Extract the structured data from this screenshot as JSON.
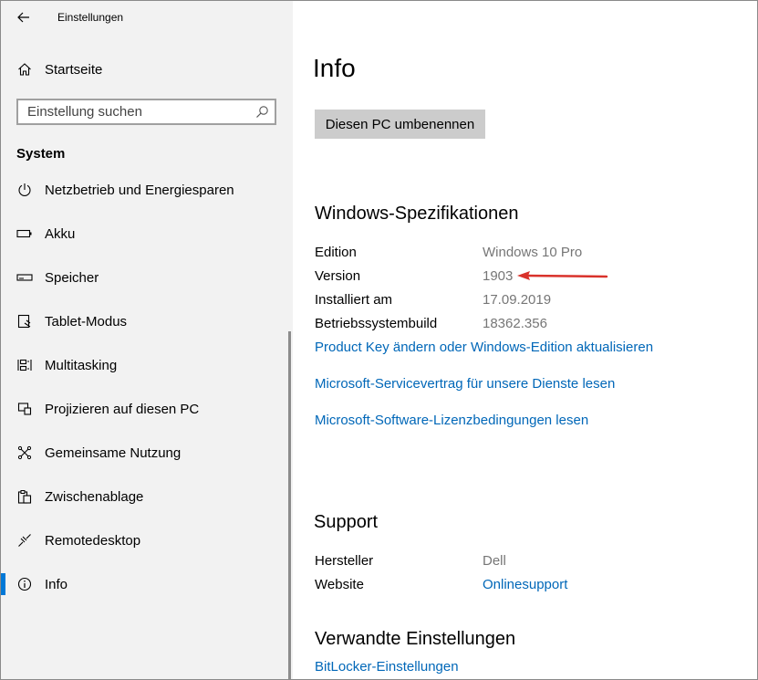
{
  "window": {
    "title": "Einstellungen"
  },
  "sidebar": {
    "home_label": "Startseite",
    "search_placeholder": "Einstellung suchen",
    "section_title": "System",
    "items": [
      {
        "label": "Netzbetrieb und Energiesparen",
        "icon": "power-icon"
      },
      {
        "label": "Akku",
        "icon": "battery-icon"
      },
      {
        "label": "Speicher",
        "icon": "storage-icon"
      },
      {
        "label": "Tablet-Modus",
        "icon": "tablet-mode-icon"
      },
      {
        "label": "Multitasking",
        "icon": "multitasking-icon"
      },
      {
        "label": "Projizieren auf diesen PC",
        "icon": "project-icon"
      },
      {
        "label": "Gemeinsame Nutzung",
        "icon": "share-icon"
      },
      {
        "label": "Zwischenablage",
        "icon": "clipboard-icon"
      },
      {
        "label": "Remotedesktop",
        "icon": "remote-desktop-icon"
      },
      {
        "label": "Info",
        "icon": "info-icon",
        "selected": true
      }
    ]
  },
  "main": {
    "title": "Info",
    "rename_button": "Diesen PC umbenennen",
    "specs": {
      "heading": "Windows-Spezifikationen",
      "rows": [
        {
          "label": "Edition",
          "value": "Windows 10 Pro"
        },
        {
          "label": "Version",
          "value": "1903"
        },
        {
          "label": "Installiert am",
          "value": "17.09.2019"
        },
        {
          "label": "Betriebssystembuild",
          "value": "18362.356"
        }
      ],
      "links": [
        "Product Key ändern oder Windows-Edition aktualisieren",
        "Microsoft-Servicevertrag für unsere Dienste lesen",
        "Microsoft-Software-Lizenzbedingungen lesen"
      ]
    },
    "support": {
      "heading": "Support",
      "manufacturer_label": "Hersteller",
      "manufacturer_value": "Dell",
      "website_label": "Website",
      "website_link": "Onlinesupport"
    },
    "related": {
      "heading": "Verwandte Einstellungen",
      "links": [
        "BitLocker-Einstellungen"
      ]
    }
  },
  "colors": {
    "accent": "#0078d7",
    "link": "#0067b8",
    "annotation_arrow": "#d9322b",
    "sidebar_bg": "#f2f2f2"
  }
}
